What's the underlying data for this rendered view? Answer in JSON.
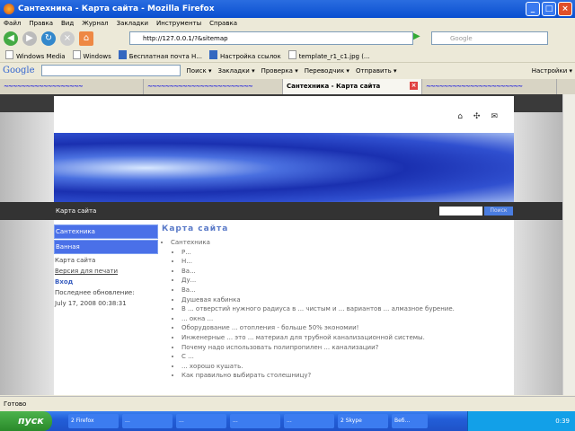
{
  "window": {
    "title": "Сантехника - Карта сайта - Mozilla Firefox"
  },
  "menu": [
    "Файл",
    "Правка",
    "Вид",
    "Журнал",
    "Закладки",
    "Инструменты",
    "Справка"
  ],
  "nav": {
    "url": "http://127.0.0.1/?&sitemap",
    "search_placeholder": "Google"
  },
  "bookmarks": [
    "Windows Media",
    "Windows",
    "Бесплатная почта Н...",
    "Настройка ссылок",
    "template_r1_c1.jpg (..."
  ],
  "google_toolbar": {
    "logo": "Google",
    "items": [
      "Поиск ▾",
      "Закладки ▾",
      "Проверка ▾",
      "Переводчик ▾",
      "Отправить ▾"
    ],
    "settings": "Настройки ▾"
  },
  "tabs": [
    {
      "label": "~~~~~~~~~~~~~~~~~~"
    },
    {
      "label": "~~~~~~~~~~~~~~~~~~~~~~~~"
    },
    {
      "label": "Сантехника - Карта сайта",
      "active": true
    },
    {
      "label": "~~~~~~~~~~~~~~~~~~~~~~"
    }
  ],
  "site": {
    "nav_label": "Карта сайта",
    "search_button": "Поиск",
    "sidebar": {
      "items": [
        "Сантехника",
        "Ванная"
      ],
      "current": "Карта сайта",
      "print": "Версия для печати",
      "login": "Вход",
      "updated_label": "Последнее обновление:",
      "updated_value": "July 17, 2008 00:38:31"
    },
    "content": {
      "title": "Карта сайта",
      "root": "Сантехника",
      "items": [
        "Р...",
        "Н...",
        "Ва...",
        "Ду...",
        "Ва...",
        "Душевая кабинка",
        "В ... отверстий нужного радиуса в ... чистым и ... вариантов ... алмазное бурение.",
        "... окна ...",
        "Оборудование ... отопления - больше 50% экономии!",
        "Инженерные ... это ... материал для трубной канализационной системы.",
        "Почему надо использовать полипропилен ... канализации?",
        "С ... ",
        "... хорошо кушать.",
        "Как правильно выбирать столешницу?"
      ]
    }
  },
  "status": "Готово",
  "taskbar": {
    "start": "пуск",
    "tasks": [
      "2 Firefox",
      "...",
      "...",
      "...",
      "...",
      "2 Skype",
      "Веб..."
    ],
    "clock": "0:39"
  }
}
